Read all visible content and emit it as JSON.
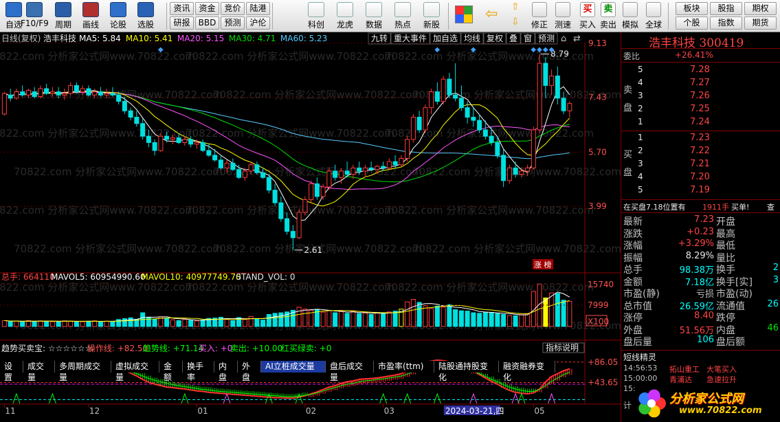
{
  "toolbar": {
    "tools": [
      {
        "key": "zixuan",
        "label": "自选",
        "icon": "star-list-icon",
        "color": "#2d6fc9"
      },
      {
        "key": "f10",
        "label": "F10/F9",
        "icon": "f10-document-icon",
        "color": "#3a6fb0"
      },
      {
        "key": "zhouqi",
        "label": "周期",
        "icon": "clock-period-icon",
        "color": "#2a5fa8"
      },
      {
        "key": "huaxian",
        "label": "画线",
        "icon": "pencil-draw-icon",
        "color": "#b03030"
      },
      {
        "key": "lungu",
        "label": "论股",
        "icon": "discuss-icon",
        "color": "#2d6fc9"
      },
      {
        "key": "xuangu",
        "label": "选股",
        "icon": "stock-picker-icon",
        "color": "#2a62b5"
      }
    ],
    "grid1": [
      "资讯",
      "资金",
      "竞价",
      "陆港",
      "研报",
      "BBD",
      "预测",
      "沪伦"
    ],
    "tools2": [
      {
        "label": "科创",
        "icon": "kechuang-chart-icon"
      },
      {
        "label": "龙虎",
        "icon": "dragon-tiger-icon"
      },
      {
        "label": "数据",
        "icon": "pe-data-icon"
      },
      {
        "label": "热点",
        "icon": "hot-flame-icon"
      },
      {
        "label": "新股",
        "icon": "ipo-new-icon"
      }
    ],
    "tools3": [
      {
        "label": "修正",
        "icon": "revise-icon"
      },
      {
        "label": "测速",
        "icon": "speed-test-icon"
      },
      {
        "label": "买入",
        "icon": "buy-icon",
        "glyph": "买"
      },
      {
        "label": "卖出",
        "icon": "sell-icon",
        "glyph": "卖"
      },
      {
        "label": "模拟",
        "icon": "simulate-hammer-icon"
      },
      {
        "label": "全球",
        "icon": "globe-icon"
      }
    ],
    "grid2": [
      "板块",
      "股指",
      "期权",
      "个股",
      "指数",
      "期货"
    ]
  },
  "chart_header": {
    "period": "日线(复权)",
    "stock_name": "浩丰科技",
    "ma": [
      {
        "label": "MA5: 5.84",
        "color": "#ffffff"
      },
      {
        "label": "MA10: 5.41",
        "color": "#ffff00"
      },
      {
        "label": "MA20: 5.15",
        "color": "#ff55ff"
      },
      {
        "label": "MA30: 4.71",
        "color": "#00dd00"
      },
      {
        "label": "MA60: 5.23",
        "color": "#55ccff"
      }
    ],
    "buttons": [
      "九转",
      "重大事件",
      "加自选",
      "均线",
      "复权",
      "叠",
      "窗",
      "预测"
    ]
  },
  "watermark": "70822.com 分析家公式网www.70822.com",
  "price_axis": {
    "labels": [
      "9.13",
      "7.43",
      "5.70",
      "3.99"
    ]
  },
  "chart_data": [
    {
      "type": "candlestick",
      "title": "浩丰科技 日线(复权)",
      "ylim": [
        2.0,
        9.13
      ],
      "high_marker": "8.79",
      "low_marker": "2.61",
      "badge": "涨 榜",
      "ohlc": [
        [
          6.9,
          7.6,
          6.85,
          7.55
        ],
        [
          7.5,
          7.7,
          7.3,
          7.4
        ],
        [
          7.4,
          7.7,
          7.35,
          7.6
        ],
        [
          7.6,
          7.8,
          7.45,
          7.5
        ],
        [
          7.5,
          7.7,
          7.4,
          7.65
        ],
        [
          7.6,
          7.75,
          7.4,
          7.45
        ],
        [
          7.45,
          7.8,
          7.4,
          7.7
        ],
        [
          7.7,
          7.85,
          7.5,
          7.55
        ],
        [
          7.55,
          7.75,
          7.45,
          7.6
        ],
        [
          7.6,
          7.75,
          7.4,
          7.5
        ],
        [
          7.5,
          7.7,
          7.35,
          7.55
        ],
        [
          7.55,
          7.9,
          7.5,
          7.8
        ],
        [
          7.8,
          7.9,
          7.55,
          7.6
        ],
        [
          7.6,
          7.8,
          7.5,
          7.7
        ],
        [
          7.7,
          7.8,
          7.45,
          7.5
        ],
        [
          7.5,
          7.7,
          7.4,
          7.6
        ],
        [
          7.6,
          7.75,
          7.45,
          7.5
        ],
        [
          7.5,
          7.7,
          7.4,
          7.55
        ],
        [
          7.55,
          7.75,
          7.45,
          7.5
        ],
        [
          7.5,
          7.6,
          7.2,
          7.3
        ],
        [
          7.3,
          7.45,
          6.9,
          7.0
        ],
        [
          7.0,
          7.1,
          6.7,
          6.8
        ],
        [
          6.8,
          7.0,
          6.5,
          6.6
        ],
        [
          6.6,
          6.75,
          6.1,
          6.2
        ],
        [
          6.2,
          6.4,
          5.85,
          6.0
        ],
        [
          6.0,
          6.1,
          5.6,
          5.75
        ],
        [
          5.75,
          6.3,
          5.7,
          6.2
        ],
        [
          6.2,
          6.35,
          6.0,
          6.1
        ],
        [
          6.1,
          6.25,
          5.95,
          6.15
        ],
        [
          6.15,
          6.3,
          5.95,
          6.0
        ],
        [
          6.0,
          6.2,
          5.9,
          6.1
        ],
        [
          6.1,
          6.2,
          5.85,
          5.95
        ],
        [
          5.95,
          6.1,
          5.8,
          6.0
        ],
        [
          6.0,
          6.1,
          5.7,
          5.75
        ],
        [
          5.75,
          5.95,
          5.55,
          5.6
        ],
        [
          5.6,
          5.8,
          5.4,
          5.45
        ],
        [
          5.45,
          5.6,
          5.15,
          5.2
        ],
        [
          5.2,
          5.45,
          5.05,
          5.35
        ],
        [
          5.35,
          5.5,
          5.1,
          5.15
        ],
        [
          5.15,
          5.3,
          4.85,
          4.9
        ],
        [
          4.9,
          5.2,
          4.8,
          5.1
        ],
        [
          5.1,
          5.4,
          5.0,
          5.3
        ],
        [
          5.3,
          5.4,
          5.0,
          5.05
        ],
        [
          5.05,
          5.2,
          4.85,
          4.9
        ],
        [
          4.9,
          5.0,
          4.4,
          4.5
        ],
        [
          4.5,
          4.7,
          4.0,
          4.1
        ],
        [
          4.1,
          4.3,
          3.5,
          3.6
        ],
        [
          3.6,
          3.8,
          3.1,
          3.2
        ],
        [
          3.2,
          3.4,
          2.61,
          3.0
        ],
        [
          3.0,
          3.9,
          2.95,
          3.8
        ],
        [
          3.8,
          4.3,
          3.7,
          4.2
        ],
        [
          4.2,
          4.8,
          4.1,
          4.7
        ],
        [
          4.7,
          4.9,
          4.2,
          4.3
        ],
        [
          4.3,
          4.7,
          4.2,
          4.6
        ],
        [
          4.6,
          5.2,
          4.5,
          5.1
        ],
        [
          5.1,
          5.3,
          4.8,
          4.9
        ],
        [
          4.9,
          5.2,
          4.7,
          5.1
        ],
        [
          5.1,
          5.4,
          4.9,
          5.0
        ],
        [
          5.0,
          5.3,
          4.85,
          5.2
        ],
        [
          5.2,
          5.4,
          5.0,
          5.1
        ],
        [
          5.1,
          5.3,
          4.9,
          5.2
        ],
        [
          5.2,
          5.4,
          5.1,
          5.15
        ],
        [
          5.15,
          5.3,
          5.0,
          5.25
        ],
        [
          5.25,
          5.4,
          5.1,
          5.2
        ],
        [
          5.2,
          5.5,
          5.15,
          5.4
        ],
        [
          5.4,
          5.6,
          5.2,
          5.3
        ],
        [
          5.3,
          5.6,
          5.25,
          5.5
        ],
        [
          5.5,
          6.2,
          5.4,
          6.1
        ],
        [
          6.1,
          6.9,
          6.0,
          6.8
        ],
        [
          6.8,
          7.0,
          6.3,
          6.4
        ],
        [
          6.4,
          7.2,
          6.3,
          7.1
        ],
        [
          7.1,
          7.7,
          6.9,
          7.6
        ],
        [
          7.6,
          7.9,
          7.2,
          7.3
        ],
        [
          7.3,
          8.1,
          7.2,
          8.0
        ],
        [
          8.0,
          8.2,
          7.4,
          7.5
        ],
        [
          7.5,
          8.5,
          7.3,
          7.4
        ],
        [
          7.4,
          7.8,
          7.0,
          7.1
        ],
        [
          7.1,
          7.3,
          6.6,
          6.8
        ],
        [
          6.8,
          7.1,
          6.5,
          6.7
        ],
        [
          6.7,
          6.9,
          6.3,
          6.4
        ],
        [
          6.4,
          6.7,
          6.1,
          6.2
        ],
        [
          6.2,
          6.5,
          5.9,
          6.0
        ],
        [
          6.0,
          6.2,
          5.5,
          5.6
        ],
        [
          5.6,
          5.8,
          4.6,
          4.8
        ],
        [
          4.8,
          5.3,
          4.7,
          5.2
        ],
        [
          5.2,
          5.4,
          4.9,
          5.0
        ],
        [
          5.0,
          5.2,
          4.9,
          5.1
        ],
        [
          5.1,
          5.3,
          4.95,
          5.2
        ],
        [
          5.2,
          6.5,
          5.15,
          6.4
        ],
        [
          6.4,
          8.79,
          6.3,
          8.5
        ],
        [
          8.5,
          8.7,
          7.4,
          7.8
        ],
        [
          7.8,
          8.3,
          7.5,
          8.1
        ],
        [
          8.1,
          8.4,
          7.2,
          7.4
        ],
        [
          7.4,
          7.6,
          6.9,
          7.0
        ],
        [
          7.0,
          7.3,
          6.8,
          7.23
        ]
      ]
    },
    {
      "type": "bar",
      "title": "成交量",
      "labels": [
        "总手: 664110",
        "MAVOL5: 60954990.60",
        "MAVOL10: 40977749.70",
        "STAND_VOL: 0"
      ],
      "yticks": [
        "15740",
        "7999",
        "X100"
      ],
      "ylim": [
        0,
        16200
      ],
      "values": [
        2100,
        1800,
        1900,
        1700,
        2100,
        1800,
        2000,
        1900,
        1700,
        1800,
        2000,
        1900,
        1800,
        1700,
        1900,
        2000,
        1800,
        1900,
        1700,
        2500,
        2800,
        3100,
        2600,
        4900,
        3300,
        2700,
        3500,
        3000,
        2400,
        2100,
        2500,
        2200,
        2000,
        2300,
        2900,
        3000,
        3300,
        2600,
        2100,
        3200,
        2500,
        3600,
        2700,
        2300,
        4300,
        4700,
        4900,
        5200,
        5800,
        6900,
        6200,
        5800,
        6100,
        5100,
        5700,
        4900,
        5300,
        4700,
        5400,
        4600,
        4800,
        4300,
        5000,
        4700,
        5200,
        5500,
        6200,
        8800,
        9700,
        8600,
        7500,
        6400,
        7300,
        6900,
        7800,
        6000,
        5600,
        5500,
        4900,
        4700,
        5100,
        5000,
        4600,
        4300,
        3900,
        3800,
        4200,
        4600,
        12500,
        15000,
        10200,
        12000,
        11800,
        9400,
        9000
      ],
      "yellow_bars": [
        66,
        90
      ]
    },
    {
      "type": "line",
      "title": "趋势买卖宝",
      "labels": [
        "趋势买卖宝: ☆☆☆☆☆☆",
        "操作线: +82.50",
        "趋势线: +71.14",
        "买入: +0",
        "卖出: +10.00",
        "红买绿卖: +0"
      ],
      "yticks": [
        "+86.05",
        "+43.65"
      ],
      "ylim": [
        0,
        100
      ],
      "series": [
        {
          "name": "操作线",
          "values": [
            82,
            80,
            79,
            81,
            83,
            84,
            82,
            80,
            81,
            79,
            80,
            83,
            84,
            83,
            82,
            82,
            81,
            80,
            79,
            76,
            70,
            63,
            57,
            50,
            44,
            40,
            37,
            34,
            33,
            31,
            30,
            28,
            26,
            25,
            23,
            22,
            21,
            20,
            19,
            18,
            17,
            16,
            15,
            14,
            13,
            12,
            12,
            11,
            11,
            13,
            16,
            20,
            24,
            29,
            34,
            37,
            42,
            45,
            47,
            50,
            51,
            52,
            53,
            55,
            57,
            59,
            62,
            68,
            76,
            82,
            86,
            88,
            90,
            89,
            87,
            84,
            80,
            75,
            68,
            60,
            53,
            46,
            40,
            33,
            27,
            23,
            21,
            20,
            22,
            30,
            45,
            56,
            62,
            68,
            72
          ]
        },
        {
          "name": "趋势线",
          "values": [
            78,
            78,
            78,
            79,
            80,
            81,
            80,
            79,
            79,
            78,
            78,
            80,
            81,
            81,
            80,
            80,
            80,
            79,
            78,
            76,
            72,
            67,
            62,
            57,
            52,
            48,
            45,
            42,
            39,
            37,
            35,
            33,
            31,
            29,
            28,
            26,
            25,
            24,
            23,
            22,
            21,
            20,
            19,
            18,
            17,
            16,
            15,
            14,
            14,
            15,
            17,
            19,
            22,
            26,
            30,
            33,
            37,
            40,
            42,
            45,
            47,
            48,
            50,
            51,
            53,
            55,
            57,
            61,
            66,
            71,
            75,
            78,
            80,
            81,
            81,
            80,
            77,
            73,
            68,
            62,
            56,
            50,
            45,
            39,
            34,
            30,
            27,
            25,
            25,
            29,
            37,
            46,
            53,
            60,
            65
          ]
        }
      ],
      "buy_signals": [
        37,
        78,
        85,
        91
      ],
      "sell_signals": [
        2,
        8,
        30,
        44,
        49,
        63,
        67,
        72,
        86
      ]
    }
  ],
  "x_axis": {
    "labels": [
      {
        "t": "11",
        "i": 0
      },
      {
        "t": "12",
        "i": 14
      },
      {
        "t": "01",
        "i": 32
      },
      {
        "t": "02",
        "i": 50
      },
      {
        "t": "03",
        "i": 63
      },
      {
        "t": "05",
        "i": 88
      }
    ],
    "highlight": {
      "label": "2024-03-21,四",
      "i": 74
    }
  },
  "volume_tabs": [
    "设置",
    "成交量",
    "多周期成交量",
    "虚拟成交量",
    "金额",
    "换手率",
    "内盘",
    "外盘",
    "AI立桩成交量",
    "盘后成交量",
    "市盈率(ttm)",
    "陆股通持股变化",
    "融资融券变化"
  ],
  "volume_tab_active": "AI立桩成交量",
  "indicator_button": "指标说明",
  "info": {
    "stock_title": "浩丰科技  300419",
    "weibi_label": "委比",
    "weibi_value": "+26.41%",
    "sell_label": "卖盘",
    "buy_label": "买盘",
    "sell_orders": [
      {
        "n": "5",
        "p": "7.28"
      },
      {
        "n": "4",
        "p": "7.27"
      },
      {
        "n": "3",
        "p": "7.26"
      },
      {
        "n": "2",
        "p": "7.25"
      },
      {
        "n": "1",
        "p": "7.24"
      }
    ],
    "buy_orders": [
      {
        "n": "1",
        "p": "7.23"
      },
      {
        "n": "2",
        "p": "7.22"
      },
      {
        "n": "3",
        "p": "7.21"
      },
      {
        "n": "4",
        "p": "7.20"
      },
      {
        "n": "5",
        "p": "7.19"
      }
    ],
    "buy_notice": "在买盘7.18位置有",
    "buy_notice_qty": "1911手",
    "buy_notice_tag": "买单!",
    "buy_notice_btn": "查",
    "stats": [
      {
        "l": "最新",
        "v": "7.23",
        "c": "#ff4444",
        "r": "开盘"
      },
      {
        "l": "涨跌",
        "v": "+0.23",
        "c": "#ff4444",
        "r": "最高"
      },
      {
        "l": "涨幅",
        "v": "+3.29%",
        "c": "#ff4444",
        "r": "最低"
      },
      {
        "l": "振幅",
        "v": "8.29%",
        "c": "#e8e8e8",
        "r": "量比"
      },
      {
        "l": "总手",
        "v": "98.38万",
        "c": "#00ffff",
        "r": "换手",
        "rv": "2"
      },
      {
        "l": "金额",
        "v": "7.18亿",
        "c": "#00ffff",
        "r": "换手[实]",
        "rv": "3"
      },
      {
        "l": "市盈(静)",
        "v": "亏损",
        "c": "#c0c0c0",
        "r": "市盈(动)"
      },
      {
        "l": "总市值",
        "v": "26.59亿",
        "c": "#00ffff",
        "r": "流通值",
        "rv": "26"
      },
      {
        "l": "涨停",
        "v": "8.40",
        "c": "#ff4444",
        "r": "跌停"
      },
      {
        "l": "外盘",
        "v": "51.56万",
        "c": "#ff4444",
        "r": "内盘",
        "rv": "46"
      },
      {
        "l": "盘后量",
        "v": "106",
        "c": "#00ffff",
        "r": "盘后额"
      }
    ],
    "short_label": "短线精灵",
    "alerts": [
      {
        "t": "14:56:53",
        "n": "拓山重工",
        "e": "大笔买入"
      },
      {
        "t": "15:00:00",
        "n": "青浦达",
        "e": "急速拉升"
      },
      {
        "t": "15:",
        "n": "",
        "e": ""
      }
    ],
    "calc_label": "计",
    "logo_text": "分析家公式网",
    "logo_url": "www.70822.com"
  }
}
